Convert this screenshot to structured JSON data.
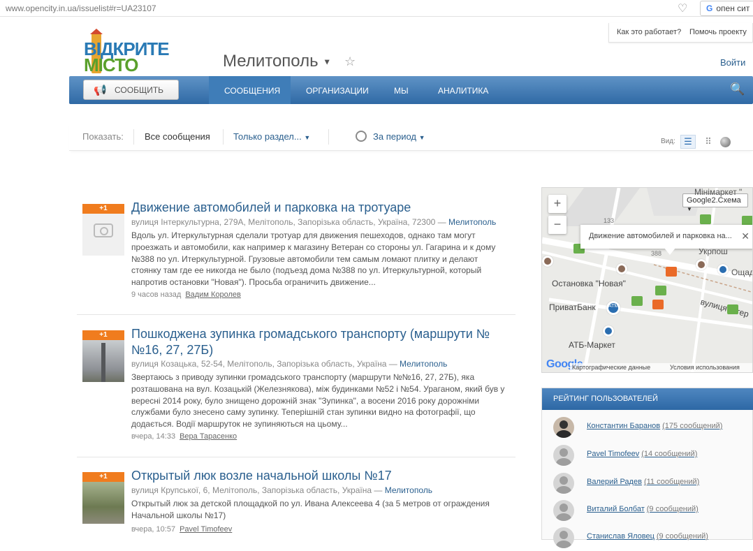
{
  "browser": {
    "url": "www.opencity.in.ua/issuelist#r=UA23107",
    "search_label": "опен сит"
  },
  "toplinks": {
    "how_it_works": "Как это работает?",
    "help_project": "Помочь проекту"
  },
  "logo": {
    "line1": "ВІДКРИТЕ",
    "line2": "МІСТО"
  },
  "header": {
    "city": "Мелитополь",
    "login": "Войти"
  },
  "nav": {
    "report_button": "СООБЩИТЬ",
    "items": [
      "СООБЩЕНИЯ",
      "ОРГАНИЗАЦИИ",
      "МЫ",
      "АНАЛИТИКА"
    ],
    "active": "СООБЩЕНИЯ"
  },
  "filters": {
    "show_label": "Показать:",
    "all": "Все сообщения",
    "only": "Только раздел...",
    "period": "За период",
    "view_label": "Вид:"
  },
  "issues": [
    {
      "votes": "+1",
      "title": "Движение автомобилей и парковка на тротуаре",
      "address": "вулиця Інтеркультурна, 279А, Мелітополь, Запорізька область, Україна, 72300 —",
      "city": "Мелитополь",
      "body": "Вдоль ул. Итеркультурная сделали тротуар для движения пешеходов, однако там могут проезжать и автомобили, как например к магазину Ветеран со стороны ул. Гагарина и к дому №388 по ул. Итеркультурной. Грузовые автомобили тем самым ломают плитку и делают стоянку там где ее никогда не было (подъезд дома №388 по ул. Итеркультурной, который напротив остановки \"Новая\"). Просьба ограничить движение...",
      "time": "9 часов назад",
      "user": "Вадим Королев"
    },
    {
      "votes": "+1",
      "title": "Пошкоджена зупинка громадського транспорту (маршрути № №16, 27, 27Б)",
      "address": "вулиця Козацька, 52-54, Мелітополь, Запорізька область, Україна —",
      "city": "Мелитополь",
      "body": "Звертаюсь з приводу зупинки громадського транспорту (маршрути №№16, 27, 27Б), яка розташована на вул. Козацькій (Железнякова), між будинками №52 і №54. Ураганом, який був у вересні 2014 року, було знищено дорожній знак \"Зупинка\", а восени 2016 року дорожніми службами було знесено саму зупинку. Теперішній стан зупинки видно на фотографії, що додається. Водії маршруток не зупиняються на цьому...",
      "time": "вчера, 14:33",
      "user": "Вера Тарасенко"
    },
    {
      "votes": "+1",
      "title": "Открытый люк возле начальной школы №17",
      "address": "вулиця Крупської, 6, Мелітополь, Запорізька область, Україна —",
      "city": "Мелитополь",
      "body": "Открытый люк за детской площадкой по ул. Ивана Алексеева 4 (за 5 метров от ограждения Начальной школы №17)",
      "time": "вчера, 10:57",
      "user": "Pavel Timofeev"
    }
  ],
  "map": {
    "type_label": "Google2.Схема",
    "tooltip": "Движение автомобилей и парковка на...",
    "labels": {
      "stop": "Остановка \"Новая\"",
      "bank": "ПриватБанк",
      "atm": "ATM",
      "market": "АТБ-Маркет",
      "minimarket": "Мінімаркет \"",
      "ukrposhta": "Укрпош",
      "oshchad": "Ощад",
      "street": "вулиця Інтер",
      "n133": "133",
      "n388": "388"
    },
    "footer_data": "Картографические данные",
    "footer_terms": "Условия использования",
    "google": "Google"
  },
  "rating": {
    "title": "РЕЙТИНГ ПОЛЬЗОВАТЕЛЕЙ",
    "users": [
      {
        "name": "Константин Баранов",
        "count": "(175 сообщений)"
      },
      {
        "name": "Pavel Timofeev",
        "count": "(14 сообщений)"
      },
      {
        "name": "Валерий Радев",
        "count": "(11 сообщений)"
      },
      {
        "name": "Виталий Болбат",
        "count": "(9 сообщений)"
      },
      {
        "name": "Станислав Яловец",
        "count": "(9 сообщений)"
      }
    ]
  }
}
